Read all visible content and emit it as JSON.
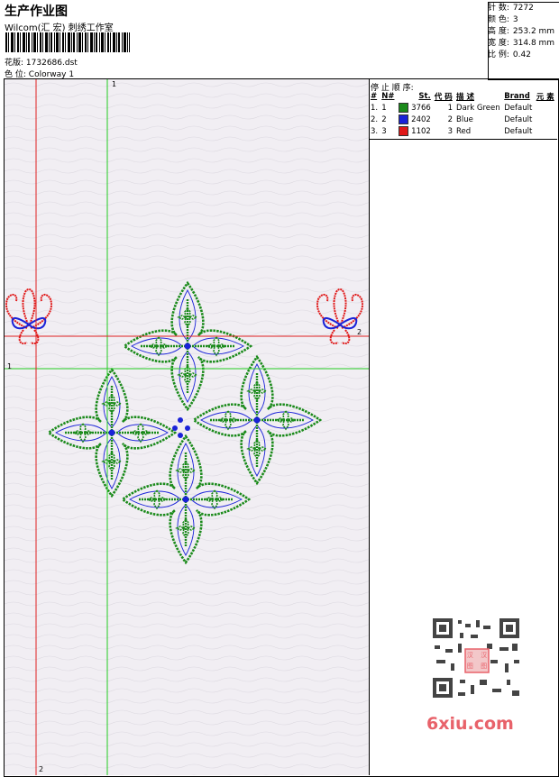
{
  "header": {
    "title": "生产作业图",
    "company": "Wilcom(汇 宏) 刺绣工作室",
    "design_label": "花版:",
    "design_value": "1732686.dst",
    "colorway_label": "色 位:",
    "colorway_value": "Colorway 1"
  },
  "stats": [
    {
      "label": "针 数:",
      "value": "7272"
    },
    {
      "label": "颜 色:",
      "value": "3"
    },
    {
      "label": "高 度:",
      "value": "253.2 mm"
    },
    {
      "label": "宽 度:",
      "value": "314.8 mm"
    },
    {
      "label": "比 例:",
      "value": "0.42"
    }
  ],
  "stop_sequence": {
    "title": "停 止 顺 序:",
    "columns": [
      "#",
      "N#",
      "St.",
      "代 码",
      "描 述",
      "Brand",
      "元 素"
    ],
    "rows": [
      {
        "num": "1.",
        "n": "1",
        "color": "#1a8a1a",
        "st": "3766",
        "code": "1",
        "desc": "Dark Green",
        "brand": "Default"
      },
      {
        "num": "2.",
        "n": "2",
        "color": "#1a22d8",
        "st": "2402",
        "code": "2",
        "desc": "Blue",
        "brand": "Default"
      },
      {
        "num": "3.",
        "n": "3",
        "color": "#e01818",
        "st": "1102",
        "code": "3",
        "desc": "Red",
        "brand": "Default"
      }
    ]
  },
  "axis_labels": {
    "green_vertical": "1",
    "green_horizontal": "1",
    "red_horizontal": "2",
    "red_vertical": "2"
  },
  "watermark": {
    "text": "6xiu.com",
    "seal_text": "汉 汉 图 图"
  },
  "colors": {
    "green": "#1a8a1a",
    "blue": "#1a22d8",
    "red": "#e01818",
    "guide_green": "#22cc22",
    "guide_red": "#e02020"
  }
}
